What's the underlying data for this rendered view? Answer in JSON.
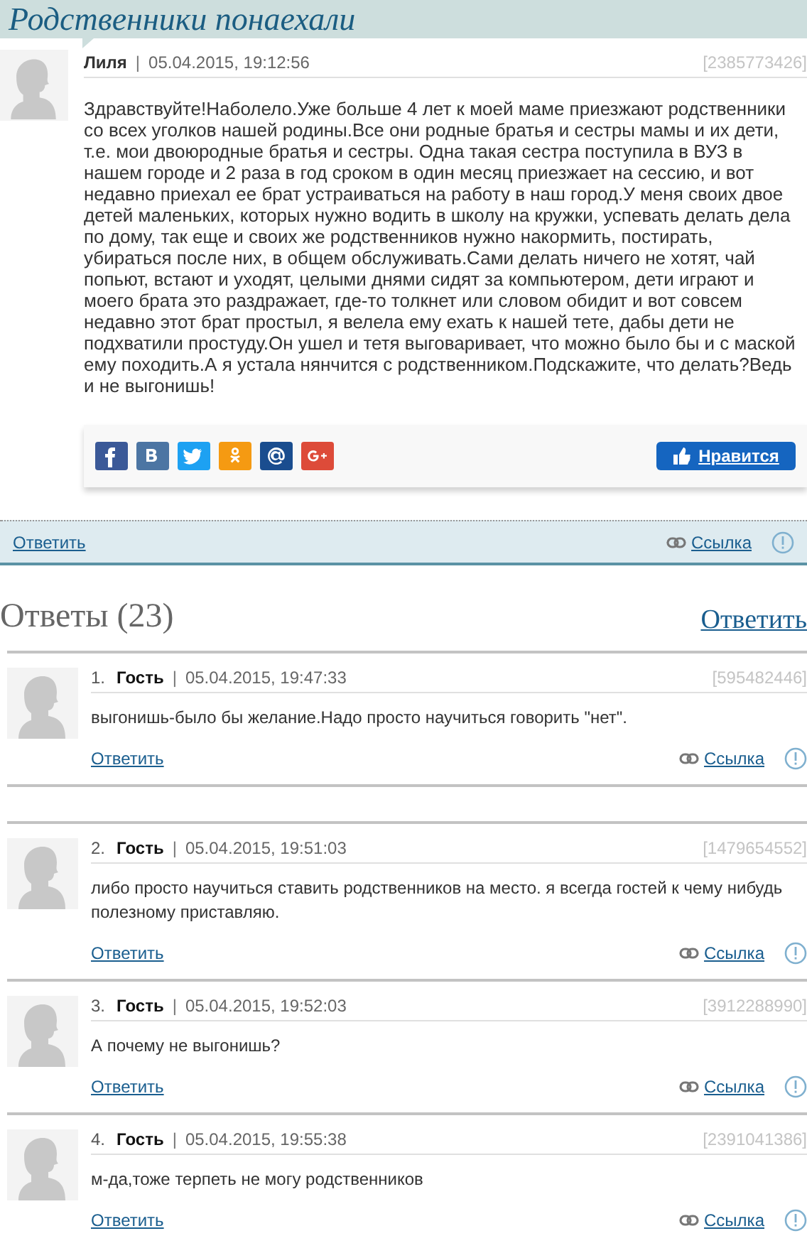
{
  "title": "Родственники понаехали",
  "post": {
    "author": "Лиля",
    "separator": "|",
    "date": "05.04.2015, 19:12:56",
    "id": "[2385773426]",
    "text": "Здравствуйте!Наболело.Уже больше 4 лет к моей маме приезжают родственники со всех уголков нашей родины.Все они родные братья и сестры мамы и их дети, т.е. мои двоюродные братья и сестры. Одна такая сестра поступила в ВУЗ в нашем городе и 2 раза в год сроком в один месяц приезжает на сессию, и вот недавно приехал ее брат устраиваться на работу в наш город.У меня своих двое детей маленьких, которых нужно водить в школу на кружки, успевать делать дела по дому, так еще и своих же родственников нужно накормить, постирать, убираться после них, в общем обслуживать.Сами делать ничего не хотят, чай попьют, встают и уходят, целыми днями сидят за компьютером, дети играют и моего брата это раздражает, где-то толкнет или словом обидит и вот совсем недавно этот брат простыл, я велела ему ехать к нашей тете, дабы дети не подхватили простуду.Он ушел и тетя выговаривает, что можно было бы и с маской ему походить.А я устала нянчится с родственником.Подскажите, что делать?Ведь и не выгонишь!",
    "share": [
      {
        "kind": "facebook",
        "color": "#3b5998"
      },
      {
        "kind": "vk",
        "color": "#4c75a3"
      },
      {
        "kind": "twitter",
        "color": "#1da1f2"
      },
      {
        "kind": "ok",
        "color": "#f59a12"
      },
      {
        "kind": "mail",
        "color": "#1a4d8f"
      },
      {
        "kind": "gplus",
        "color": "#dd4b39"
      }
    ],
    "like": "Нравится",
    "reply": "Ответить",
    "link": "Ссылка"
  },
  "answers": {
    "heading": "Ответы (23)",
    "reply": "Ответить",
    "items": [
      {
        "number": "1.",
        "author": "Гость",
        "separator": "|",
        "date": "05.04.2015, 19:47:33",
        "id": "[595482446]",
        "text": "выгонишь-было бы желание.Надо просто научиться говорить \"нет\".",
        "reply": "Ответить",
        "link": "Ссылка"
      },
      {
        "number": "2.",
        "author": "Гость",
        "separator": "|",
        "date": "05.04.2015, 19:51:03",
        "id": "[1479654552]",
        "text": "либо просто научиться ставить родственников на место. я всегда гостей к чему нибудь полезному приставляю.",
        "reply": "Ответить",
        "link": "Ссылка"
      },
      {
        "number": "3.",
        "author": "Гость",
        "separator": "|",
        "date": "05.04.2015, 19:52:03",
        "id": "[3912288990]",
        "text": "А почему не выгонишь?",
        "reply": "Ответить",
        "link": "Ссылка"
      },
      {
        "number": "4.",
        "author": "Гость",
        "separator": "|",
        "date": "05.04.2015, 19:55:38",
        "id": "[2391041386]",
        "text": "м-да,тоже терпеть не могу родственников",
        "reply": "Ответить",
        "link": "Ссылка"
      }
    ]
  }
}
